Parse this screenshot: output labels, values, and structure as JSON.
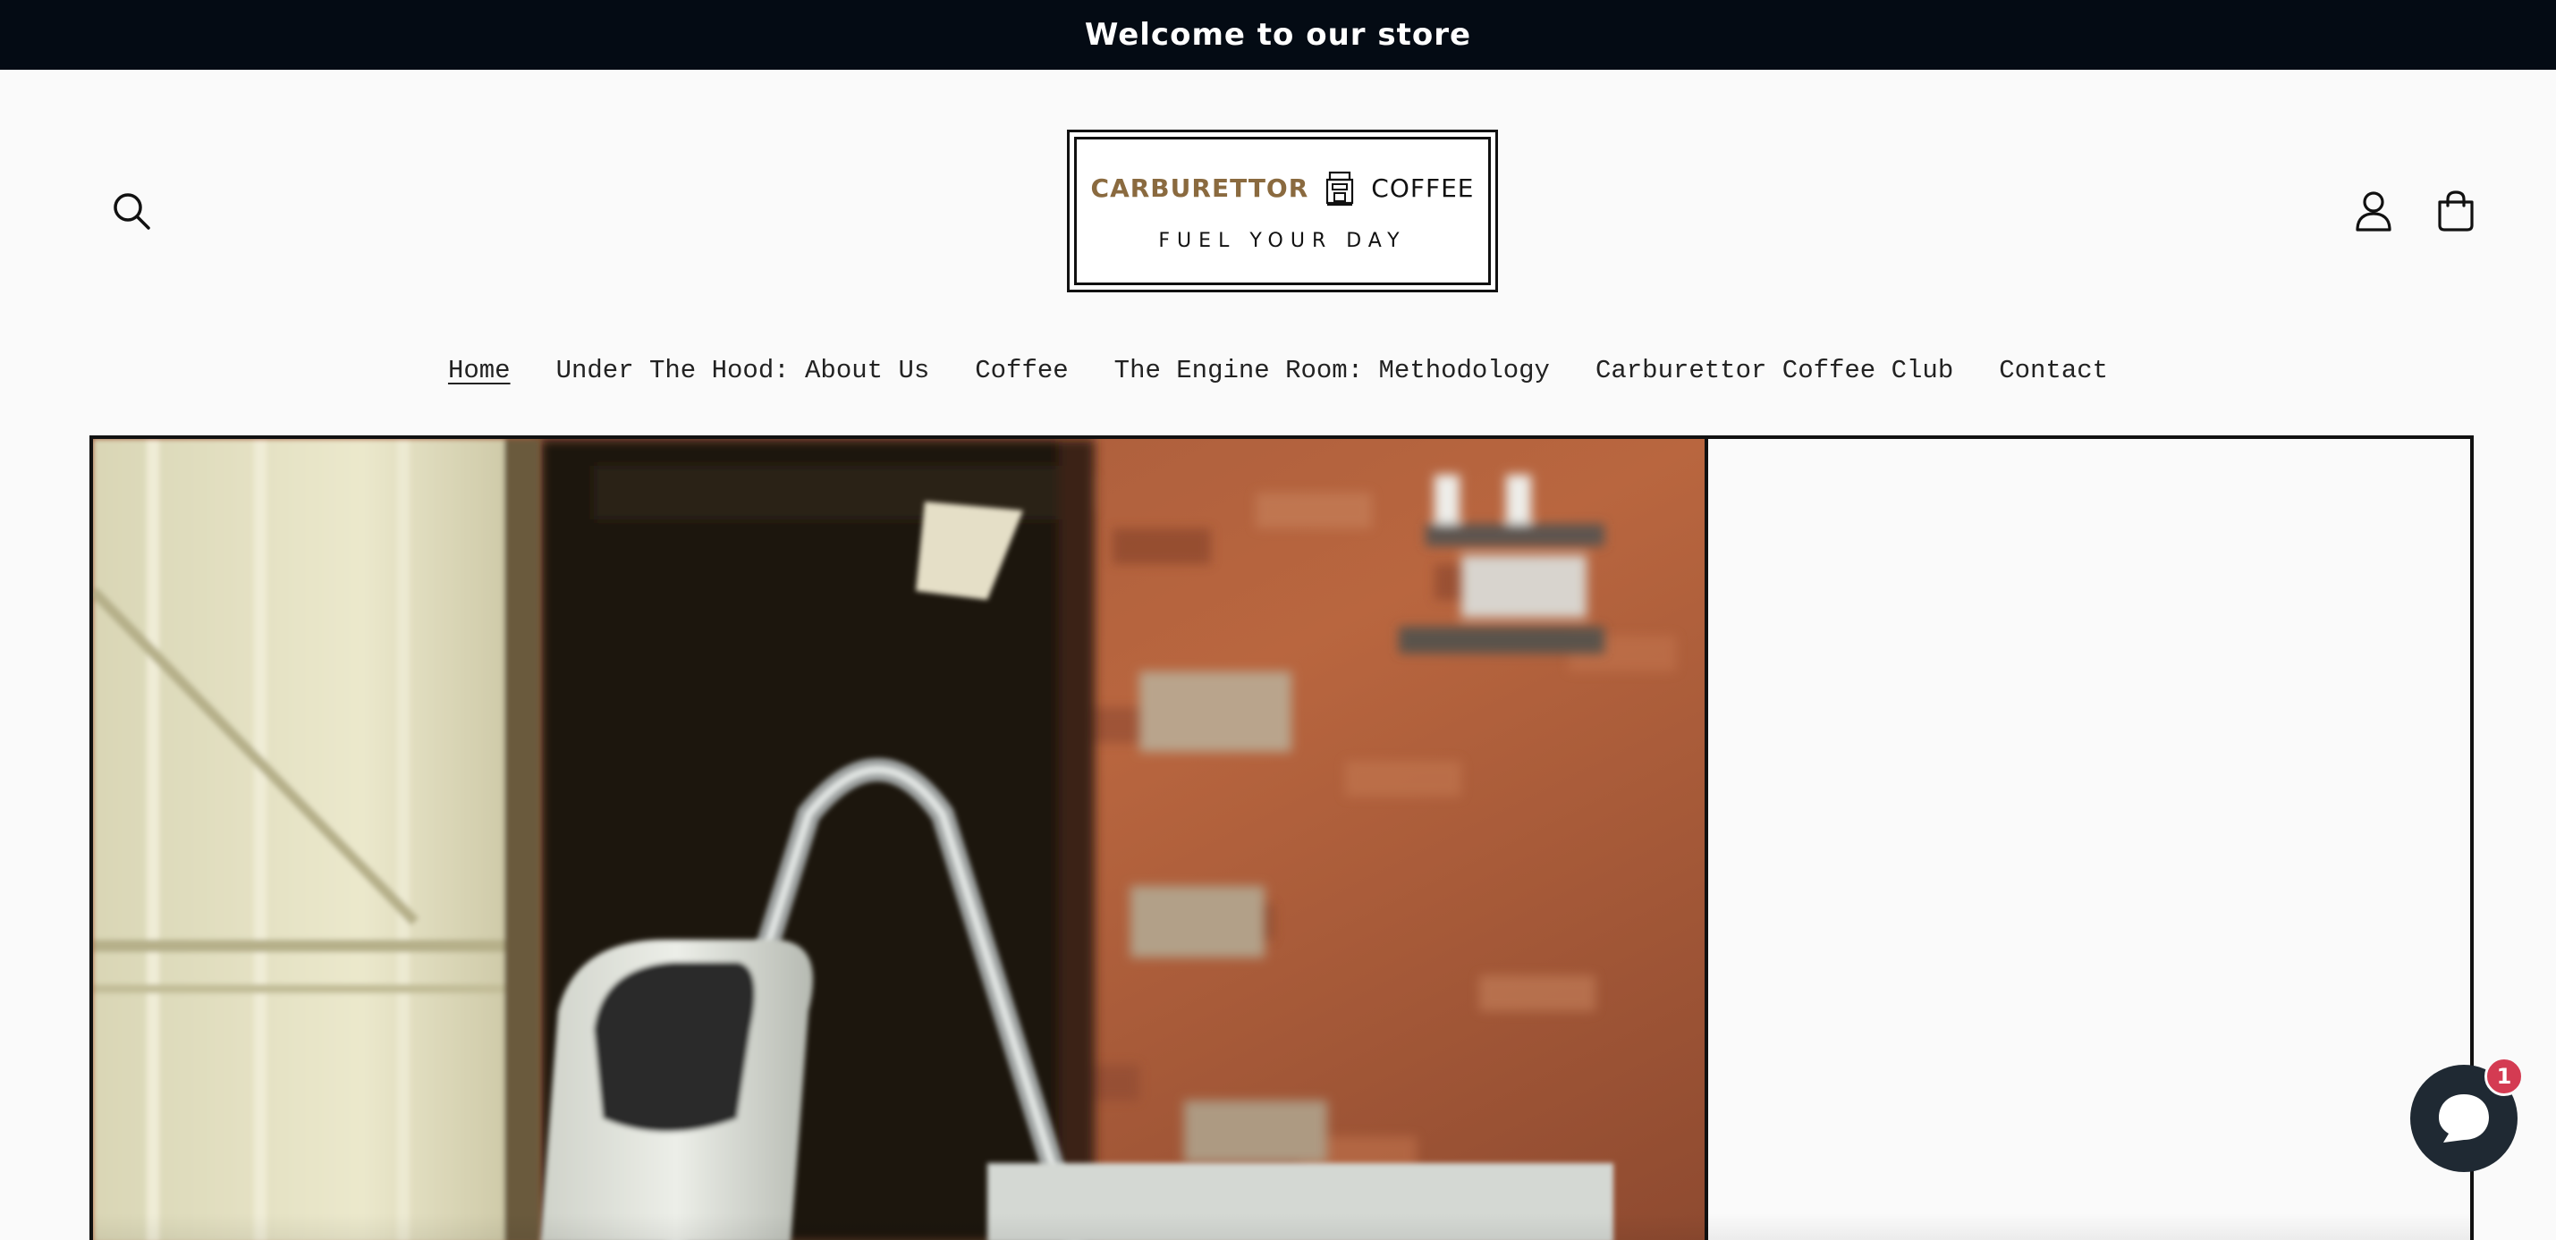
{
  "announcement": {
    "text": "Welcome to our store"
  },
  "header": {
    "search_icon": "search-icon",
    "account_icon": "account-icon",
    "cart_icon": "cart-icon",
    "logo": {
      "brand_part_1": "CARBURETTOR",
      "brand_part_2": "COFFEE",
      "tagline": "FUEL YOUR DAY",
      "emblem_icon": "coffee-machine-icon"
    }
  },
  "nav": {
    "items": [
      {
        "label": "Home",
        "active": true
      },
      {
        "label": "Under The Hood: About Us",
        "active": false
      },
      {
        "label": "Coffee",
        "active": false
      },
      {
        "label": "The Engine Room: Methodology",
        "active": false
      },
      {
        "label": "Carburettor Coffee Club",
        "active": false
      },
      {
        "label": "Contact",
        "active": false
      }
    ]
  },
  "hero": {
    "image_subject": "espresso machine in front of brick garage doorway"
  },
  "chat": {
    "icon": "chat-bubble-icon",
    "badge_count": "1"
  },
  "colors": {
    "announcement_bg": "#040b14",
    "page_bg": "#fafafa",
    "logo_accent": "#8a6a3f",
    "badge": "#d43b52",
    "chat_bg": "#1f2933"
  }
}
